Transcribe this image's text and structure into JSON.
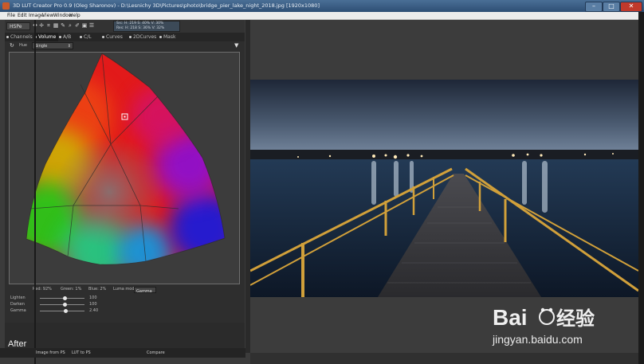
{
  "window": {
    "title": "3D LUT Creator Pro 0.9 (Oleg Sharonov) - D:\\Lesnichy 3D\\Pictures\\photo\\bridge_pier_lake_night_2018.jpg [1920x1080]",
    "buttons": {
      "minimize": "–",
      "maximize": "□",
      "close": "✕"
    }
  },
  "menu": [
    "File",
    "Edit",
    "Image",
    "View",
    "Window",
    "Help"
  ],
  "toolbar": {
    "colorspace": "HSPe",
    "icons": [
      "move-icon",
      "crosshair-icon",
      "transform-icon",
      "grid-icon",
      "picker-icon",
      "zoom-icon",
      "eyedropper-icon",
      "save-icon",
      "settings-icon"
    ],
    "readout": {
      "line1": "Src: H: 219 S: 40% V: 30%",
      "line2": "Res: H: 218 S: 36% V: 32%"
    }
  },
  "tabs": [
    {
      "label": "Channels",
      "active": false
    },
    {
      "label": "Volume",
      "active": true
    },
    {
      "label": "A/B",
      "active": false
    },
    {
      "label": "C/L",
      "active": false
    },
    {
      "label": "Curves",
      "active": false
    },
    {
      "label": "2DCurves",
      "active": false
    },
    {
      "label": "Mask",
      "active": false
    }
  ],
  "mode": {
    "label": "Hue",
    "value": "Single",
    "menu_icon": "▼"
  },
  "color_readout": {
    "red": "Red: 92%",
    "green": "Green: 1%",
    "blue": "Blue: 2%",
    "luma_mode_label": "Luma mode",
    "luma_mode_value": "Gamma"
  },
  "sliders": [
    {
      "label": "Lighten",
      "value": "100",
      "level": 0.55
    },
    {
      "label": "Darken",
      "value": "100",
      "level": 0.55
    },
    {
      "label": "Gamma",
      "value": "2.40",
      "level": 0.58
    }
  ],
  "bottom": {
    "load_button": "Image from PS",
    "lut_button": "LUT to PS",
    "compare": "Compare"
  },
  "overlay": {
    "after": "After"
  },
  "watermark": {
    "url": "jingyan.baidu.com"
  },
  "colors": {
    "accent": "#2d4e74",
    "panel": "#2b2b2b",
    "close": "#c0392b",
    "pier_rail": "#d1a03a"
  }
}
